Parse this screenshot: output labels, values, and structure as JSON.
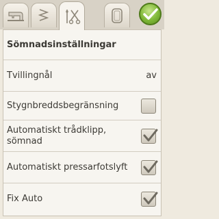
{
  "tabs": [
    {
      "name": "sewing-machine-icon"
    },
    {
      "name": "stitch-icon"
    },
    {
      "name": "needle-scissors-icon"
    },
    {
      "name": "hoop-icon"
    }
  ],
  "confirm": {
    "icon": "check-icon"
  },
  "panel": {
    "title": "Sömnadsinställningar",
    "rows": [
      {
        "label": "Tvillingnål",
        "value": "av"
      },
      {
        "label": "Stygnbreddsbegränsning",
        "checked": false
      },
      {
        "label": "Automatiskt trådklipp, sömnad",
        "checked": true
      },
      {
        "label": "Automatiskt pressarfotslyft",
        "checked": true
      },
      {
        "label": "Fix Auto",
        "checked": true
      }
    ]
  }
}
